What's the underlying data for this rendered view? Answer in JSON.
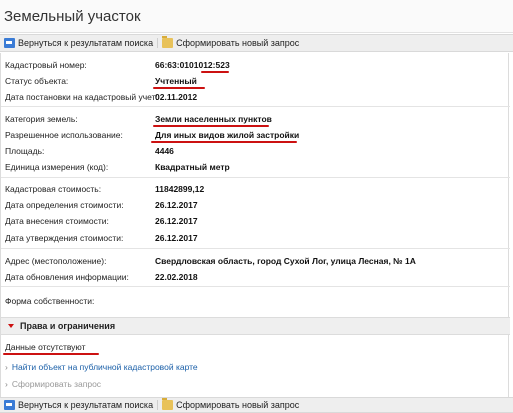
{
  "page": {
    "title": "Земельный участок"
  },
  "toolbar": {
    "back_label": "Вернуться к результатам поиска",
    "new_query_label": "Сформировать новый запрос"
  },
  "fields": [
    {
      "label": "Кадастровый номер:",
      "value": "66:63:0101012:523"
    },
    {
      "label": "Статус объекта:",
      "value": "Учтенный"
    },
    {
      "label": "Дата постановки на кадастровый учет:",
      "value": "02.11.2012"
    },
    {
      "label": "Категория земель:",
      "value": "Земли населенных пунктов"
    },
    {
      "label": "Разрешенное использование:",
      "value": "Для иных видов жилой застройки"
    },
    {
      "label": "Площадь:",
      "value": "4446"
    },
    {
      "label": "Единица измерения (код):",
      "value": "Квадратный метр"
    },
    {
      "label": "Кадастровая стоимость:",
      "value": "11842899,12"
    },
    {
      "label": "Дата определения стоимости:",
      "value": "26.12.2017"
    },
    {
      "label": "Дата внесения стоимости:",
      "value": "26.12.2017"
    },
    {
      "label": "Дата утверждения стоимости:",
      "value": "26.12.2017"
    },
    {
      "label": "Адрес (местоположение):",
      "value": "Свердловская область, город Сухой Лог, улица Лесная, № 1А"
    },
    {
      "label": "Дата обновления информации:",
      "value": "22.02.2018"
    },
    {
      "label": "Форма собственности:",
      "value": ""
    }
  ],
  "rights_section": {
    "title": "Права и ограничения",
    "empty_text": "Данные отсутствуют"
  },
  "links": {
    "map_link": "Найти объект на публичной кадастровой карте",
    "form_query": "Сформировать запрос",
    "chevron": "›"
  },
  "colors": {
    "underline": "#cc1111",
    "link": "#1a5fa8"
  }
}
